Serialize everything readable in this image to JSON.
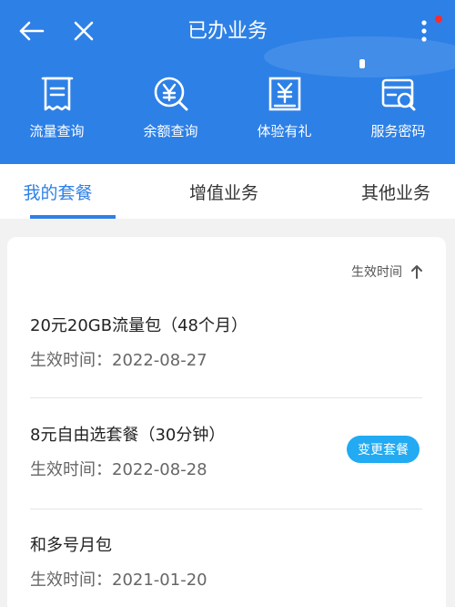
{
  "header": {
    "title": "已办业务",
    "bg_color": "#2d80e6",
    "notification_dot_color": "#ff2a2a"
  },
  "quick_actions": [
    {
      "label": "流量查询",
      "icon": "receipt-icon"
    },
    {
      "label": "余额查询",
      "icon": "yen-search-icon"
    },
    {
      "label": "体验有礼",
      "icon": "yen-gift-icon"
    },
    {
      "label": "服务密码",
      "icon": "card-search-icon"
    }
  ],
  "tabs": [
    {
      "label": "我的套餐",
      "active": true
    },
    {
      "label": "增值业务",
      "active": false
    },
    {
      "label": "其他业务",
      "active": false
    }
  ],
  "list": {
    "sort_label": "生效时间",
    "items": [
      {
        "name": "20元20GB流量包（48个月）",
        "date": "生效时间：2022-08-27"
      },
      {
        "name": "8元自由选套餐（30分钟）",
        "date": "生效时间：2022-08-28",
        "action": "变更套餐"
      },
      {
        "name": "和多号月包",
        "date": "生效时间：2021-01-20"
      }
    ]
  },
  "accent_color": "#2d80e6",
  "button_color": "#22aaf2"
}
